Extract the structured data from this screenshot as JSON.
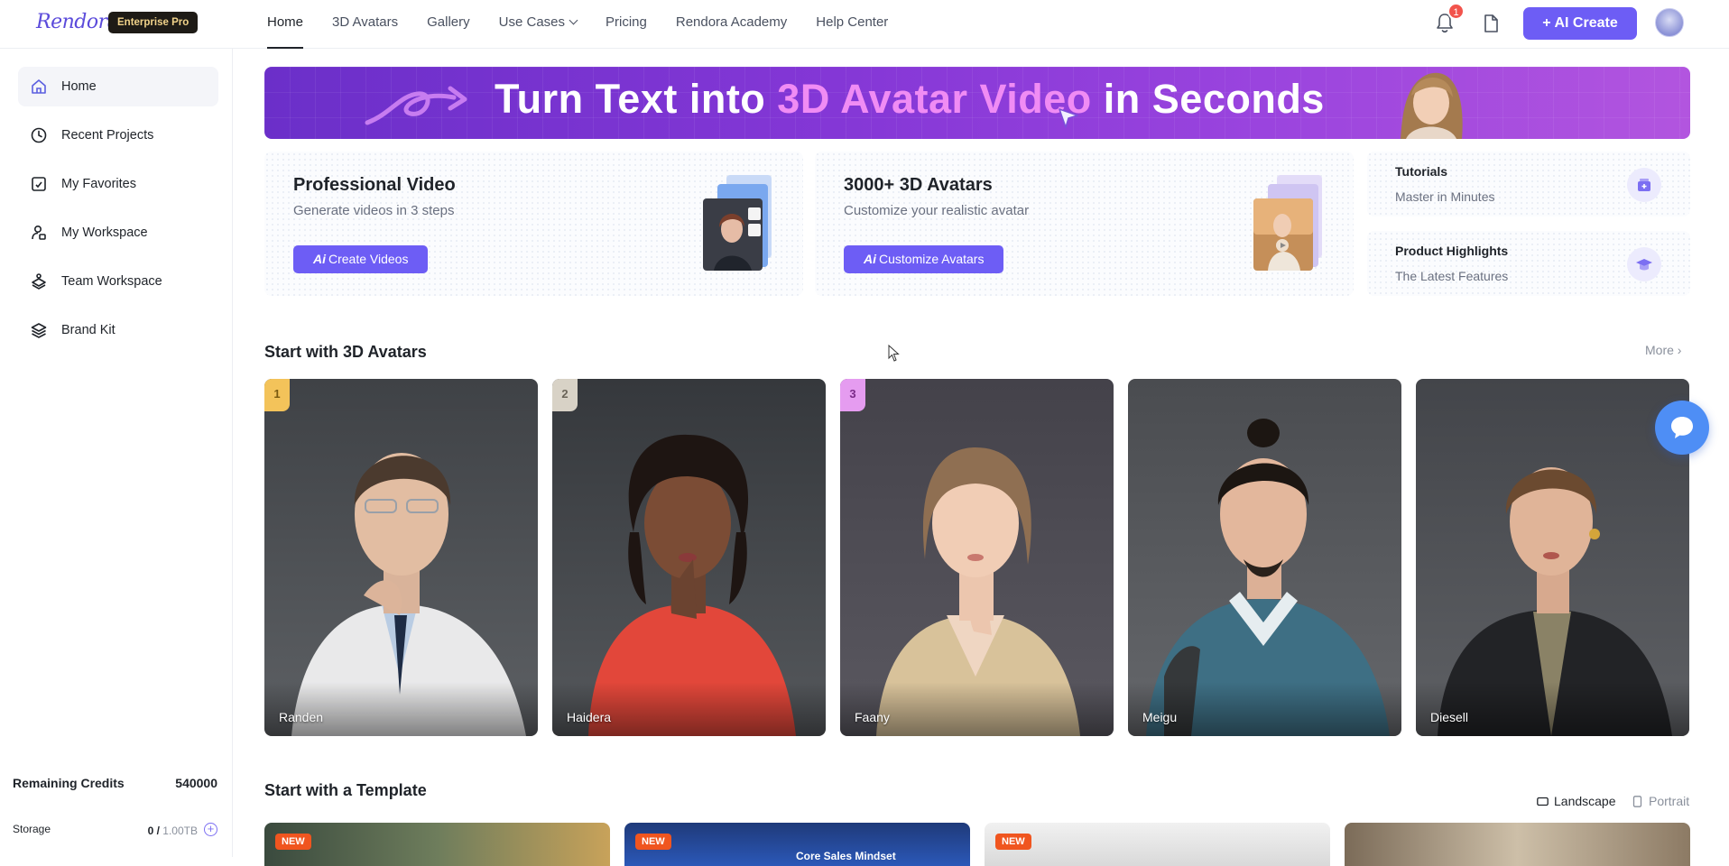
{
  "app": {
    "logo_text": "Rendora",
    "plan_badge": "Enterprise Pro"
  },
  "nav": {
    "items": [
      {
        "label": "Home",
        "active": true
      },
      {
        "label": "3D Avatars"
      },
      {
        "label": "Gallery"
      },
      {
        "label": "Use Cases",
        "dropdown": true
      },
      {
        "label": "Pricing"
      },
      {
        "label": "Rendora Academy"
      },
      {
        "label": "Help Center"
      }
    ],
    "notification_count": "1",
    "ai_create_label": "AI Create"
  },
  "sidebar": {
    "items": [
      {
        "label": "Home",
        "icon": "home-icon",
        "active": true
      },
      {
        "label": "Recent Projects",
        "icon": "clock-icon"
      },
      {
        "label": "My Favorites",
        "icon": "favorites-icon"
      },
      {
        "label": "My Workspace",
        "icon": "workspace-icon"
      },
      {
        "label": "Team Workspace",
        "icon": "team-icon"
      },
      {
        "label": "Brand Kit",
        "icon": "layers-icon"
      }
    ],
    "credits_label": "Remaining Credits",
    "credits_value": "540000",
    "storage_label": "Storage",
    "storage_used": "0 / ",
    "storage_total": "1.00TB"
  },
  "banner": {
    "text_before": "Turn Text into ",
    "text_highlight": "3D Avatar Video",
    "text_after": " in Seconds"
  },
  "feature_cards": [
    {
      "title": "Professional Video",
      "subtitle": "Generate videos in 3 steps",
      "button_prefix": "Ai",
      "button_label": "Create Videos"
    },
    {
      "title": "3000+ 3D Avatars",
      "subtitle": "Customize your realistic avatar",
      "button_prefix": "Ai",
      "button_label": "Customize Avatars"
    }
  ],
  "side_cards": [
    {
      "title": "Tutorials",
      "subtitle": "Master in Minutes",
      "icon": "tutorial-icon"
    },
    {
      "title": "Product Highlights",
      "subtitle": "The Latest Features",
      "icon": "graduation-cap-icon"
    }
  ],
  "avatars_section": {
    "title": "Start with 3D Avatars",
    "more_label": "More",
    "avatars": [
      {
        "name": "Randen",
        "rank": "1",
        "rank_color": "#f3c35a"
      },
      {
        "name": "Haidera",
        "rank": "2",
        "rank_color": "#d8d2c6"
      },
      {
        "name": "Faany",
        "rank": "3",
        "rank_color": "#e59cf0"
      },
      {
        "name": "Meigu",
        "rank": ""
      },
      {
        "name": "Diesell",
        "rank": ""
      }
    ]
  },
  "template_section": {
    "title": "Start with a Template",
    "landscape_label": "Landscape",
    "portrait_label": "Portrait",
    "templates": [
      {
        "tag": "NEW",
        "title": ""
      },
      {
        "tag": "NEW",
        "title": "Core Sales Mindset"
      },
      {
        "tag": "NEW",
        "title": ""
      },
      {
        "tag": "",
        "title": ""
      }
    ]
  },
  "colors": {
    "accent": "#6d5df5",
    "badge_red": "#f2534c",
    "chat_blue": "#4e8ef5",
    "new_tag": "#f0551f"
  }
}
